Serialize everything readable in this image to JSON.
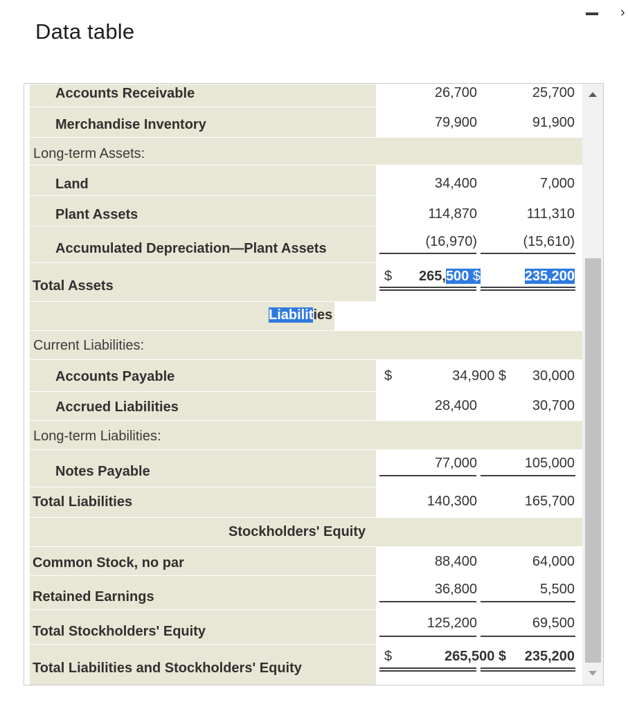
{
  "dialog": {
    "title": "Data table",
    "minimize_icon": "minimize-icon",
    "close_glyph": "›"
  },
  "colors": {
    "row_shade": "#e8e6d5",
    "selection": "#2f7ae0",
    "scroll_thumb": "#c1c1c1"
  },
  "rows": {
    "accounts_receivable": {
      "label": "Accounts Receivable",
      "col1": "26,700",
      "col2": "25,700"
    },
    "merchandise_inventory": {
      "label": "Merchandise Inventory",
      "col1": "79,900",
      "col2": "91,900"
    },
    "long_term_assets": {
      "label": "Long-term Assets:"
    },
    "land": {
      "label": "Land",
      "col1": "34,400",
      "col2": "7,000"
    },
    "plant_assets": {
      "label": "Plant Assets",
      "col1": "114,870",
      "col2": "111,310"
    },
    "accumulated_depreciation": {
      "label": "Accumulated Depreciation—Plant Assets",
      "col1": "(16,970)",
      "col2": "(15,610)"
    },
    "total_assets": {
      "label": "Total Assets",
      "currency1": "$",
      "col1_part1": "265,",
      "col1_part2": "500",
      "col1_space": " ",
      "currency2": "$",
      "col2": "235,200"
    },
    "liabilities_header": {
      "label_part1": "Liabilit",
      "label_part2": "ies"
    },
    "current_liabilities": {
      "label": "Current Liabilities:"
    },
    "accounts_payable": {
      "label": "Accounts Payable",
      "currency1": "$",
      "col1": "34,900 $",
      "col2": "30,000"
    },
    "accrued_liabilities": {
      "label": "Accrued Liabilities",
      "col1": "28,400",
      "col2": "30,700"
    },
    "long_term_liabilities": {
      "label": "Long-term Liabilities:"
    },
    "notes_payable": {
      "label": "Notes Payable",
      "col1": "77,000",
      "col2": "105,000"
    },
    "total_liabilities": {
      "label": "Total Liabilities",
      "col1": "140,300",
      "col2": "165,700"
    },
    "equity_header": {
      "label": "Stockholders' Equity"
    },
    "common_stock": {
      "label": "Common Stock, no par",
      "col1": "88,400",
      "col2": "64,000"
    },
    "retained_earnings": {
      "label": "Retained Earnings",
      "col1": "36,800",
      "col2": "5,500"
    },
    "total_equity": {
      "label": "Total Stockholders' Equity",
      "col1": "125,200",
      "col2": "69,500"
    },
    "total_liab_equity": {
      "label": "Total Liabilities and Stockholders' Equity",
      "currency1": "$",
      "col1": "265,500 $",
      "col2": "235,200"
    }
  },
  "scrollbar": {
    "up_icon": "scroll-up-arrow-icon",
    "down_icon": "scroll-down-arrow-icon"
  }
}
